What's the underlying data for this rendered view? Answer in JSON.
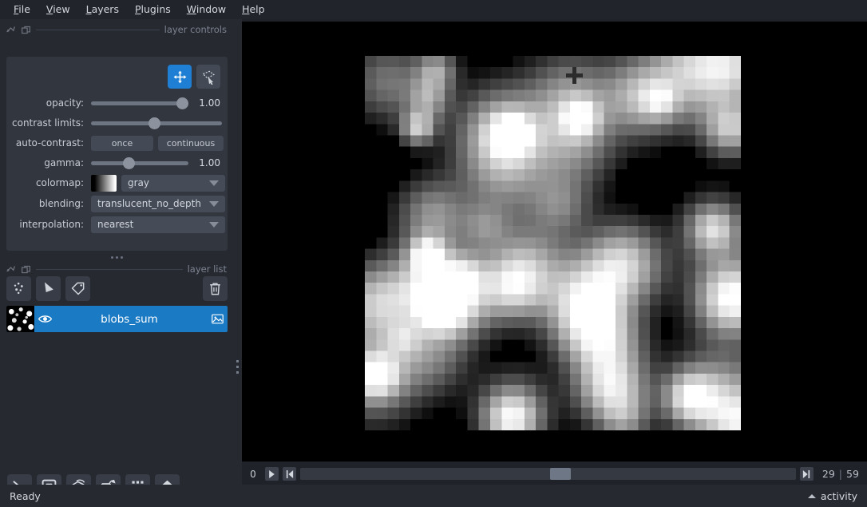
{
  "menu": {
    "items": [
      {
        "label": "File",
        "mnemonic": "F"
      },
      {
        "label": "View",
        "mnemonic": "V"
      },
      {
        "label": "Layers",
        "mnemonic": "L"
      },
      {
        "label": "Plugins",
        "mnemonic": "P"
      },
      {
        "label": "Window",
        "mnemonic": "W"
      },
      {
        "label": "Help",
        "mnemonic": "H"
      }
    ]
  },
  "layer_controls": {
    "dock_title": "layer controls",
    "tools": [
      {
        "name": "pan-zoom-tool",
        "active": true
      },
      {
        "name": "transform-tool",
        "active": false
      }
    ],
    "opacity": {
      "label": "opacity:",
      "value": "1.00",
      "percent": 100
    },
    "contrast_limits": {
      "label": "contrast limits:",
      "percent": 48
    },
    "auto_contrast": {
      "label": "auto-contrast:",
      "once": "once",
      "continuous": "continuous"
    },
    "gamma": {
      "label": "gamma:",
      "value": "1.00",
      "percent": 37
    },
    "colormap": {
      "label": "colormap:",
      "value": "gray"
    },
    "blending": {
      "label": "blending:",
      "value": "translucent_no_depth"
    },
    "interpolation": {
      "label": "interpolation:",
      "value": "nearest"
    }
  },
  "layer_list": {
    "dock_title": "layer list",
    "actions": [
      {
        "name": "new-points-layer-button"
      },
      {
        "name": "new-shapes-layer-button"
      },
      {
        "name": "new-labels-layer-button"
      },
      {
        "name": "delete-layer-button"
      }
    ],
    "layers": [
      {
        "name": "blobs_sum",
        "visible": true,
        "selected": true,
        "type": "image"
      }
    ]
  },
  "viewer_buttons": [
    {
      "name": "console-button"
    },
    {
      "name": "ndisplay-toggle-button"
    },
    {
      "name": "roll-dims-button"
    },
    {
      "name": "transpose-dims-button"
    },
    {
      "name": "grid-view-button"
    },
    {
      "name": "reset-view-button"
    }
  ],
  "dims": {
    "axis_label": "0",
    "current": "29",
    "max": "59",
    "play_button": "play",
    "prev_button": "previous-frame",
    "next_button": "next-frame",
    "knob_percent": 50.4
  },
  "status": {
    "text": "Ready",
    "activity_label": "activity"
  },
  "colors": {
    "accent": "#1a7ac4",
    "panel": "#32363f",
    "sidebar": "#262930",
    "canvas": "#000000",
    "menubar": "#21242b"
  }
}
